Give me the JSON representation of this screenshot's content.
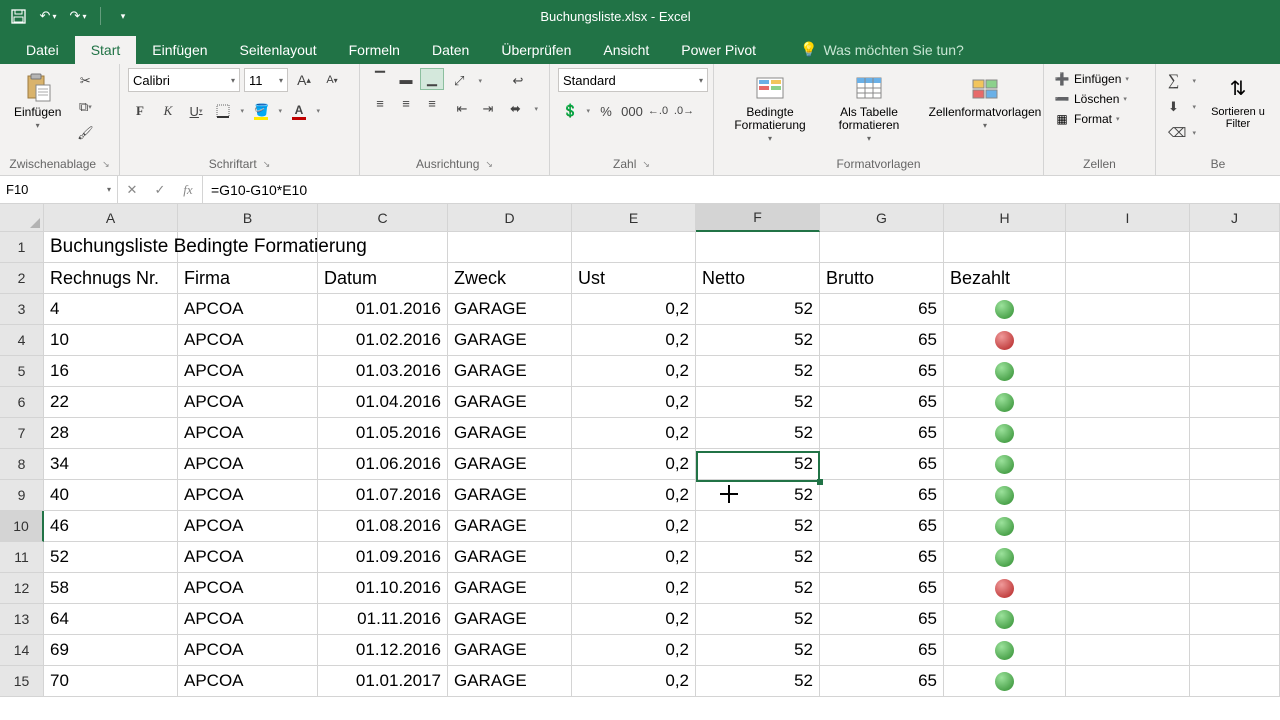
{
  "titlebar": {
    "title": "Buchungsliste.xlsx - Excel"
  },
  "tabs": {
    "file": "Datei",
    "home": "Start",
    "insert": "Einfügen",
    "pageLayout": "Seitenlayout",
    "formulas": "Formeln",
    "data": "Daten",
    "review": "Überprüfen",
    "view": "Ansicht",
    "powerPivot": "Power Pivot",
    "tellMe": "Was möchten Sie tun?"
  },
  "ribbon": {
    "clipboard": {
      "label": "Zwischenablage",
      "paste": "Einfügen"
    },
    "font": {
      "label": "Schriftart",
      "family": "Calibri",
      "size": "11"
    },
    "alignment": {
      "label": "Ausrichtung"
    },
    "number": {
      "label": "Zahl",
      "format": "Standard",
      "percent": "%",
      "thousand": "000"
    },
    "styles": {
      "label": "Formatvorlagen",
      "conditional": "Bedingte Formatierung",
      "table": "Als Tabelle formatieren",
      "cellStyles": "Zellenformatvorlagen"
    },
    "cells": {
      "label": "Zellen",
      "insert": "Einfügen",
      "delete": "Löschen",
      "format": "Format"
    },
    "editing": {
      "sort": "Sortieren u Filter",
      "labelFrag": "Be"
    }
  },
  "formulaBar": {
    "cellRef": "F10",
    "formula": "=G10-G10*E10"
  },
  "columns": [
    "A",
    "B",
    "C",
    "D",
    "E",
    "F",
    "G",
    "H",
    "I",
    "J"
  ],
  "activeColIndex": 5,
  "activeRow": 10,
  "sheet": {
    "row1": {
      "a": "Buchungsliste Bedingte Formatierung"
    },
    "headers": {
      "a": "Rechnugs Nr.",
      "b": "Firma",
      "c": "Datum",
      "d": "Zweck",
      "e": "Ust",
      "f": "Netto",
      "g": "Brutto",
      "h": "Bezahlt"
    },
    "rows": [
      {
        "n": 3,
        "a": "4",
        "b": "APCOA",
        "c": "01.01.2016",
        "d": "GARAGE",
        "e": "0,2",
        "f": "52",
        "g": "65",
        "h": "green"
      },
      {
        "n": 4,
        "a": "10",
        "b": "APCOA",
        "c": "01.02.2016",
        "d": "GARAGE",
        "e": "0,2",
        "f": "52",
        "g": "65",
        "h": "red"
      },
      {
        "n": 5,
        "a": "16",
        "b": "APCOA",
        "c": "01.03.2016",
        "d": "GARAGE",
        "e": "0,2",
        "f": "52",
        "g": "65",
        "h": "green"
      },
      {
        "n": 6,
        "a": "22",
        "b": "APCOA",
        "c": "01.04.2016",
        "d": "GARAGE",
        "e": "0,2",
        "f": "52",
        "g": "65",
        "h": "green"
      },
      {
        "n": 7,
        "a": "28",
        "b": "APCOA",
        "c": "01.05.2016",
        "d": "GARAGE",
        "e": "0,2",
        "f": "52",
        "g": "65",
        "h": "green"
      },
      {
        "n": 8,
        "a": "34",
        "b": "APCOA",
        "c": "01.06.2016",
        "d": "GARAGE",
        "e": "0,2",
        "f": "52",
        "g": "65",
        "h": "green"
      },
      {
        "n": 9,
        "a": "40",
        "b": "APCOA",
        "c": "01.07.2016",
        "d": "GARAGE",
        "e": "0,2",
        "f": "52",
        "g": "65",
        "h": "green"
      },
      {
        "n": 10,
        "a": "46",
        "b": "APCOA",
        "c": "01.08.2016",
        "d": "GARAGE",
        "e": "0,2",
        "f": "52",
        "g": "65",
        "h": "green"
      },
      {
        "n": 11,
        "a": "52",
        "b": "APCOA",
        "c": "01.09.2016",
        "d": "GARAGE",
        "e": "0,2",
        "f": "52",
        "g": "65",
        "h": "green"
      },
      {
        "n": 12,
        "a": "58",
        "b": "APCOA",
        "c": "01.10.2016",
        "d": "GARAGE",
        "e": "0,2",
        "f": "52",
        "g": "65",
        "h": "red"
      },
      {
        "n": 13,
        "a": "64",
        "b": "APCOA",
        "c": "01.11.2016",
        "d": "GARAGE",
        "e": "0,2",
        "f": "52",
        "g": "65",
        "h": "green"
      },
      {
        "n": 14,
        "a": "69",
        "b": "APCOA",
        "c": "01.12.2016",
        "d": "GARAGE",
        "e": "0,2",
        "f": "52",
        "g": "65",
        "h": "green"
      },
      {
        "n": 15,
        "a": "70",
        "b": "APCOA",
        "c": "01.01.2017",
        "d": "GARAGE",
        "e": "0,2",
        "f": "52",
        "g": "65",
        "h": "green"
      }
    ]
  }
}
